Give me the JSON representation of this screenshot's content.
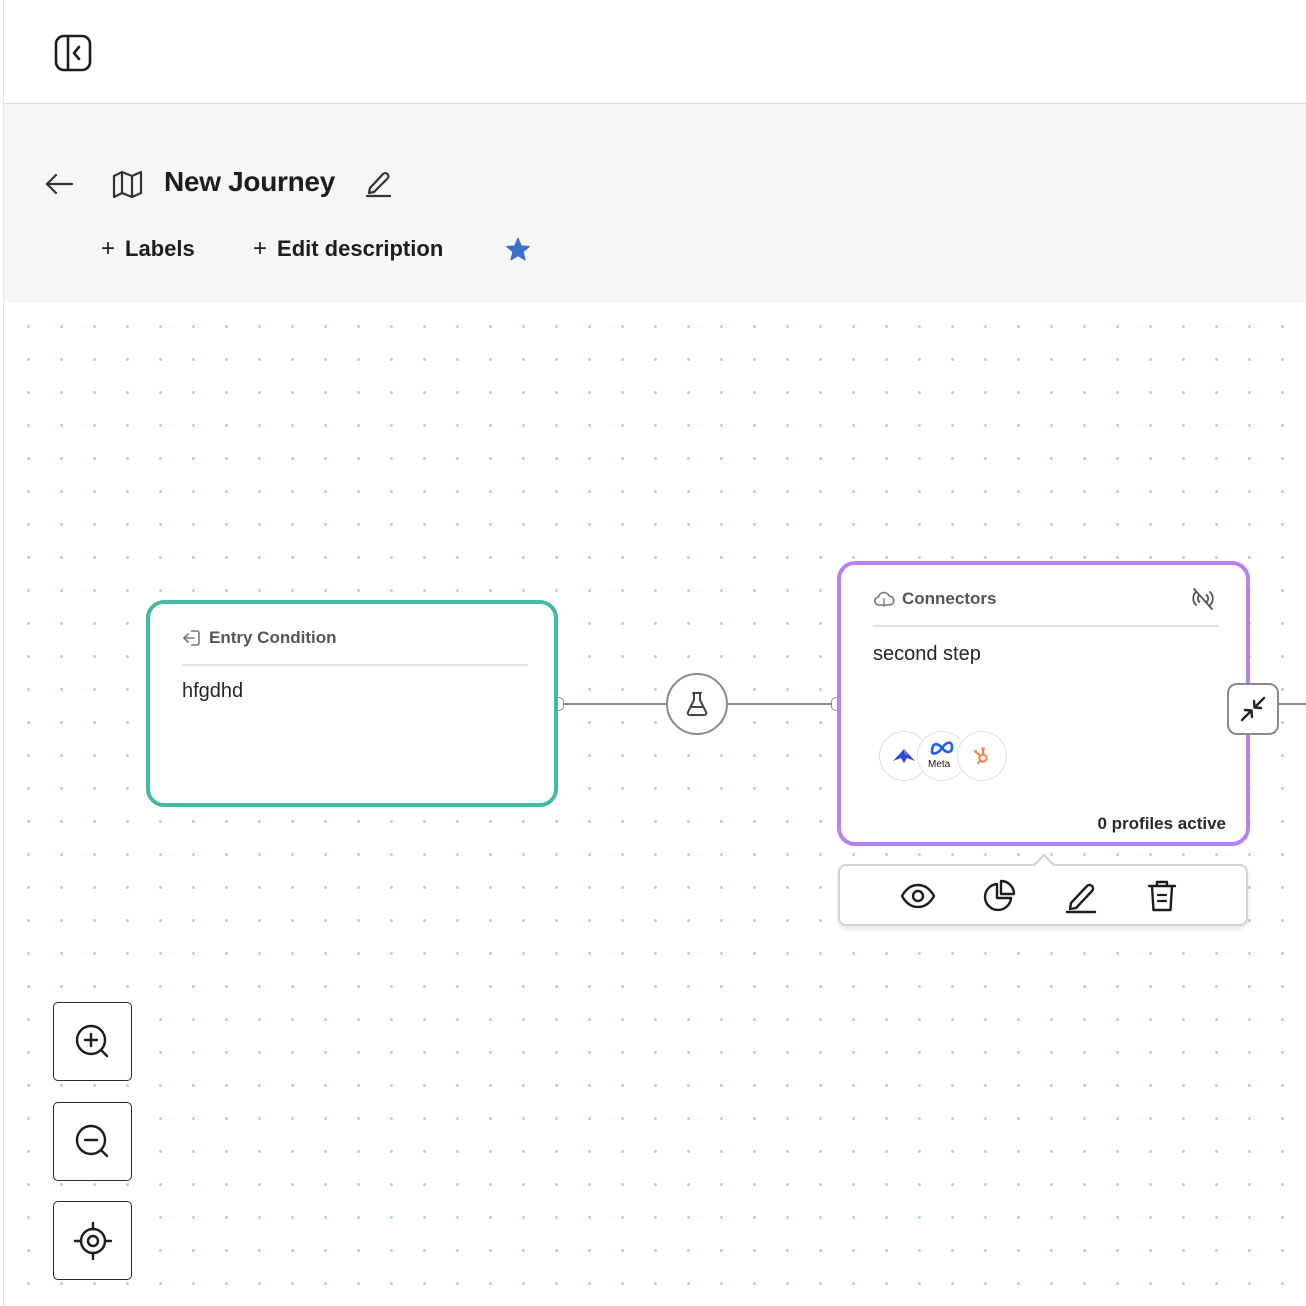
{
  "topbar": {
    "sidebar_toggle_icon": "sidebar-collapse-icon"
  },
  "header": {
    "back_icon": "arrow-left-icon",
    "journey_icon": "map-icon",
    "title": "New Journey",
    "edit_icon": "pencil-icon",
    "labels_action": "Labels",
    "description_action": "Edit description",
    "plus_glyph": "+",
    "star_icon": "star-icon",
    "star_color": "#3a6fd0"
  },
  "canvas": {
    "nodes": [
      {
        "id": "entry",
        "type_label": "Entry Condition",
        "type_icon": "entry-arrow-icon",
        "body": "hfgdhd",
        "border_color": "#45b8a5"
      },
      {
        "id": "connectors",
        "type_label": "Connectors",
        "type_icon": "cloud-icon",
        "status_icon": "no-signal-icon",
        "body": "second step",
        "connector_logos": [
          "arrow-logo",
          "meta-logo",
          "hubspot-logo"
        ],
        "meta_text": "Meta",
        "profiles_active": "0 profiles active",
        "border_color": "#b880f5"
      }
    ],
    "edge_node_icon": "flask-icon",
    "collapse_icon": "collapse-arrows-icon",
    "node_toolbar": [
      "eye-icon",
      "pie-chart-icon",
      "pencil-icon",
      "trash-icon"
    ],
    "zoom_controls": [
      "zoom-in-icon",
      "zoom-out-icon",
      "recenter-icon"
    ]
  }
}
